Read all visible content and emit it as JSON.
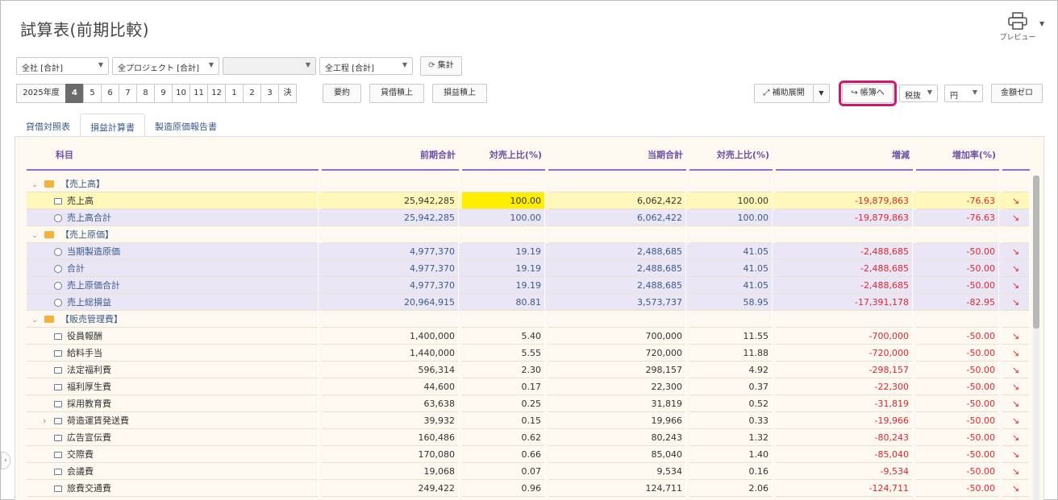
{
  "title": "試算表(前期比較)",
  "preview_label": "プレビュー",
  "filters": {
    "company": "全社 [合計]",
    "project": "全プロジェクト [合計]",
    "blank": "",
    "process": "全工程 [合計]",
    "aggregate_label": "集計"
  },
  "periods": {
    "year": "2025年度",
    "items": [
      "4",
      "5",
      "6",
      "7",
      "8",
      "9",
      "10",
      "11",
      "12",
      "1",
      "2",
      "3",
      "決"
    ],
    "active": "4"
  },
  "toolbar": {
    "summary": "要約",
    "bs_total": "貸借積上",
    "pl_total": "損益積上",
    "expand": "補助展開",
    "ledger": "帳簿へ",
    "tax": "税抜",
    "currency": "円",
    "zero": "金額ゼロ"
  },
  "tabs": [
    "貸借対照表",
    "損益計算書",
    "製造原価報告書"
  ],
  "active_tab": "損益計算書",
  "columns": [
    "科目",
    "前期合計",
    "対売上比(%)",
    "当期合計",
    "対売上比(%)",
    "増減",
    "増加率(%)"
  ],
  "rows": [
    {
      "type": "cat",
      "name": "【売上高】"
    },
    {
      "type": "hl",
      "name": "売上高",
      "prev": "25,942,285",
      "prev_ratio": "100.00",
      "cur": "6,062,422",
      "cur_ratio": "100.00",
      "diff": "-19,879,863",
      "rate": "-76.63"
    },
    {
      "type": "sub",
      "name": "売上高合計",
      "prev": "25,942,285",
      "prev_ratio": "100.00",
      "cur": "6,062,422",
      "cur_ratio": "100.00",
      "diff": "-19,879,863",
      "rate": "-76.63"
    },
    {
      "type": "cat",
      "name": "【売上原価】"
    },
    {
      "type": "sub",
      "name": "当期製造原価",
      "prev": "4,977,370",
      "prev_ratio": "19.19",
      "cur": "2,488,685",
      "cur_ratio": "41.05",
      "diff": "-2,488,685",
      "rate": "-50.00"
    },
    {
      "type": "sub",
      "name": "合計",
      "prev": "4,977,370",
      "prev_ratio": "19.19",
      "cur": "2,488,685",
      "cur_ratio": "41.05",
      "diff": "-2,488,685",
      "rate": "-50.00"
    },
    {
      "type": "sub",
      "name": "売上原価合計",
      "prev": "4,977,370",
      "prev_ratio": "19.19",
      "cur": "2,488,685",
      "cur_ratio": "41.05",
      "diff": "-2,488,685",
      "rate": "-50.00"
    },
    {
      "type": "sub",
      "name": "売上総損益",
      "prev": "20,964,915",
      "prev_ratio": "80.81",
      "cur": "3,573,737",
      "cur_ratio": "58.95",
      "diff": "-17,391,178",
      "rate": "-82.95"
    },
    {
      "type": "cat",
      "name": "【販売管理費】"
    },
    {
      "type": "norm",
      "name": "役員報酬",
      "prev": "1,400,000",
      "prev_ratio": "5.40",
      "cur": "700,000",
      "cur_ratio": "11.55",
      "diff": "-700,000",
      "rate": "-50.00"
    },
    {
      "type": "norm",
      "name": "給料手当",
      "prev": "1,440,000",
      "prev_ratio": "5.55",
      "cur": "720,000",
      "cur_ratio": "11.88",
      "diff": "-720,000",
      "rate": "-50.00"
    },
    {
      "type": "norm",
      "name": "法定福利費",
      "prev": "596,314",
      "prev_ratio": "2.30",
      "cur": "298,157",
      "cur_ratio": "4.92",
      "diff": "-298,157",
      "rate": "-50.00"
    },
    {
      "type": "norm",
      "name": "福利厚生費",
      "prev": "44,600",
      "prev_ratio": "0.17",
      "cur": "22,300",
      "cur_ratio": "0.37",
      "diff": "-22,300",
      "rate": "-50.00"
    },
    {
      "type": "norm",
      "name": "採用教育費",
      "prev": "63,638",
      "prev_ratio": "0.25",
      "cur": "31,819",
      "cur_ratio": "0.52",
      "diff": "-31,819",
      "rate": "-50.00"
    },
    {
      "type": "norm",
      "name": "荷造運賃発送費",
      "expand": true,
      "prev": "39,932",
      "prev_ratio": "0.15",
      "cur": "19,966",
      "cur_ratio": "0.33",
      "diff": "-19,966",
      "rate": "-50.00"
    },
    {
      "type": "norm",
      "name": "広告宣伝費",
      "prev": "160,486",
      "prev_ratio": "0.62",
      "cur": "80,243",
      "cur_ratio": "1.32",
      "diff": "-80,243",
      "rate": "-50.00"
    },
    {
      "type": "norm",
      "name": "交際費",
      "prev": "170,080",
      "prev_ratio": "0.66",
      "cur": "85,040",
      "cur_ratio": "1.40",
      "diff": "-85,040",
      "rate": "-50.00"
    },
    {
      "type": "norm",
      "name": "会議費",
      "prev": "19,068",
      "prev_ratio": "0.07",
      "cur": "9,534",
      "cur_ratio": "0.16",
      "diff": "-9,534",
      "rate": "-50.00"
    },
    {
      "type": "norm",
      "name": "旅費交通費",
      "prev": "249,422",
      "prev_ratio": "0.96",
      "cur": "124,711",
      "cur_ratio": "2.06",
      "diff": "-124,711",
      "rate": "-50.00"
    }
  ]
}
